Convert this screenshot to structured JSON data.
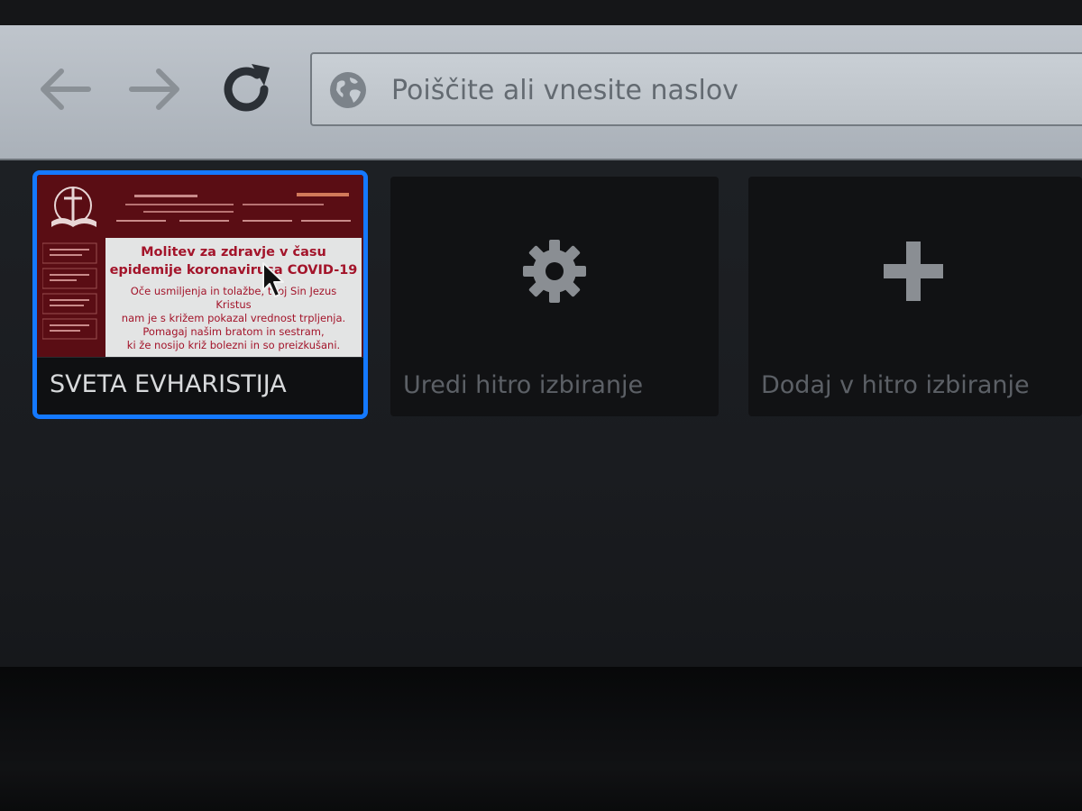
{
  "browser": {
    "url_placeholder": "Poiščite ali vnesite naslov",
    "url_value": ""
  },
  "speed_dial": {
    "tiles": [
      {
        "label": "SVETA EVHARISTIJA",
        "selected": true,
        "thumbnail": {
          "title_line_1": "Molitev za zdravje v času",
          "title_line_2": "epidemije koronavirusa COVID-19",
          "text_line_1": "Oče usmiljenja in tolažbe, tvoj Sin Jezus",
          "text_line_2": "Kristus",
          "text_line_3": "nam je s križem pokazal vrednost trpljenja.",
          "text_line_4": "Pomagaj našim bratom in sestram,",
          "text_line_5": "ki že nosijo križ bolezni in so preizkušani."
        }
      },
      {
        "label": "Uredi hitro izbiranje",
        "icon": "gear-icon"
      },
      {
        "label": "Dodaj v hitro izbiranje",
        "icon": "plus-icon"
      }
    ]
  },
  "colors": {
    "focus_ring": "#1479ff",
    "toolbar": "#b4bbc2",
    "thumbnail_bg": "#5a0d14",
    "thumbnail_text": "#a3142a"
  }
}
